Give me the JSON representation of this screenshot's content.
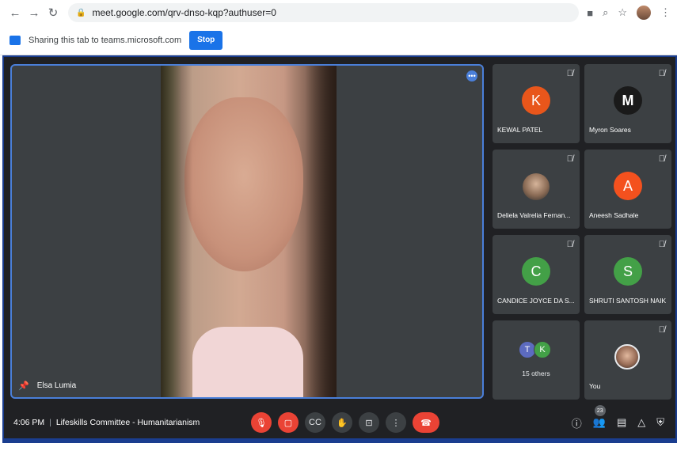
{
  "browser": {
    "url": "meet.google.com/qrv-dnso-kqp?authuser=0"
  },
  "share_bar": {
    "message": "Sharing this tab to teams.microsoft.com",
    "stop_label": "Stop"
  },
  "main_speaker": {
    "name": "Elsa Lumia"
  },
  "participants": [
    {
      "name": "KEWAL PATEL",
      "initial": "K",
      "color": "#e8561b"
    },
    {
      "name": "Myron Soares",
      "initial": "M",
      "color": "#1a1a1a"
    },
    {
      "name": "Deliela Valrelia Fernan...",
      "initial": "",
      "color": ""
    },
    {
      "name": "Aneesh Sadhale",
      "initial": "A",
      "color": "#f4511e"
    },
    {
      "name": "CANDICE JOYCE DA S...",
      "initial": "C",
      "color": "#43a047"
    },
    {
      "name": "SHRUTI SANTOSH NAIK",
      "initial": "S",
      "color": "#43a047"
    },
    {
      "name": "15 others",
      "initial": "",
      "color": ""
    },
    {
      "name": "You",
      "initial": "",
      "color": ""
    }
  ],
  "others_avatars": [
    {
      "initial": "T",
      "color": "#5c6bc0"
    },
    {
      "initial": "K",
      "color": "#43a047"
    }
  ],
  "meeting": {
    "time": "4:06 PM",
    "separator": "|",
    "title": "Lifeskills Committee - Humanitarianism",
    "people_count": "23"
  },
  "icons": {
    "back": "back-arrow-icon",
    "forward": "forward-arrow-icon",
    "reload": "reload-icon",
    "lock": "lock-icon",
    "mic_off": "mic-off-icon",
    "cam_off": "camera-off-icon",
    "captions": "captions-icon",
    "raise_hand": "raise-hand-icon",
    "present": "present-icon",
    "more": "more-options-icon",
    "end_call": "end-call-icon",
    "info": "info-icon",
    "people": "people-icon",
    "chat": "chat-icon",
    "activities": "activities-icon",
    "host_controls": "host-controls-icon"
  }
}
